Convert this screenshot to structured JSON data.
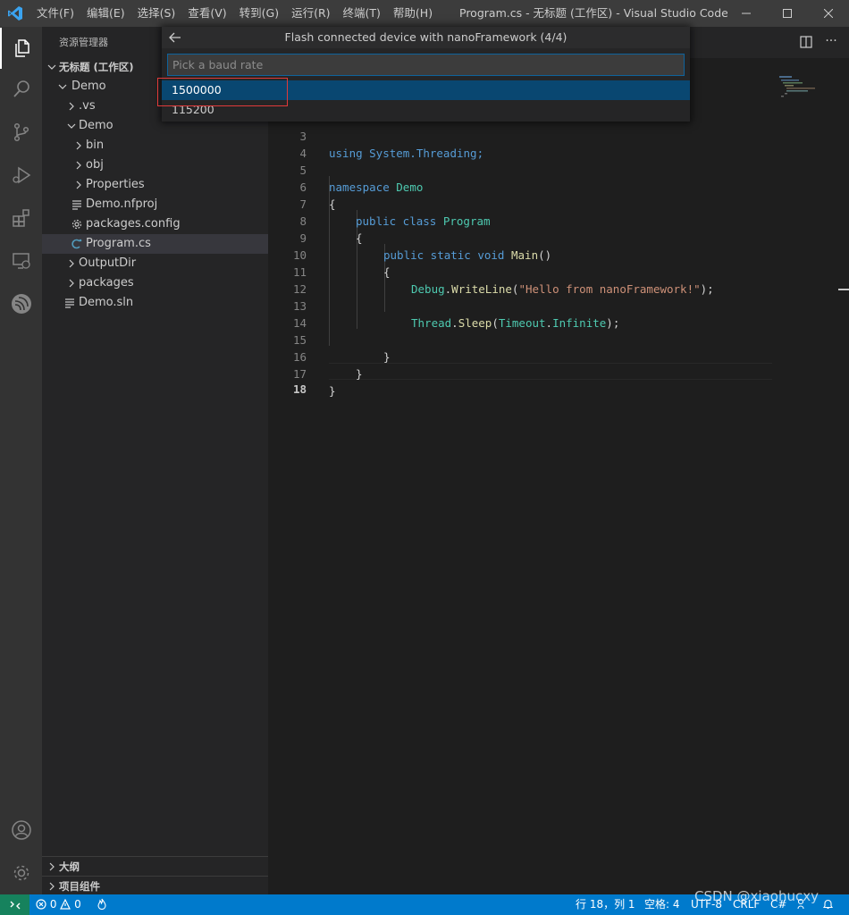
{
  "titlebar": {
    "menu": [
      "文件(F)",
      "编辑(E)",
      "选择(S)",
      "查看(V)",
      "转到(G)",
      "运行(R)",
      "终端(T)",
      "帮助(H)"
    ],
    "window_title": "Program.cs - 无标题 (工作区) - Visual Studio Code [管..."
  },
  "sidebar": {
    "header": "资源管理器",
    "workspace": "无标题 (工作区)",
    "tree": [
      {
        "label": "Demo"
      },
      {
        "label": ".vs"
      },
      {
        "label": "Demo"
      },
      {
        "label": "bin"
      },
      {
        "label": "obj"
      },
      {
        "label": "Properties"
      },
      {
        "label": "Demo.nfproj"
      },
      {
        "label": "packages.config"
      },
      {
        "label": "Program.cs"
      },
      {
        "label": "OutputDir"
      },
      {
        "label": "packages"
      },
      {
        "label": "Demo.sln"
      }
    ],
    "outline": "大纲",
    "project_components": "项目组件"
  },
  "editor": {
    "line_numbers": [
      "3",
      "4",
      "5",
      "6",
      "7",
      "8",
      "9",
      "10",
      "11",
      "12",
      "13",
      "14",
      "15",
      "16",
      "17",
      "18"
    ],
    "lines": {
      "l3": "using System.Threading;",
      "l5_kw": "namespace",
      "l5_ty": "Demo",
      "l6": "{",
      "l7_kw": "public class",
      "l7_ty": "Program",
      "l8": "{",
      "l9_kw": "public static void",
      "l9_fn": "Main",
      "l9_p": "()",
      "l10": "{",
      "l11_ty": "Debug",
      "l11_dot": ".",
      "l11_fn": "WriteLine",
      "l11_open": "(",
      "l11_str": "\"Hello from nanoFramework!\"",
      "l11_close": ");",
      "l13_ty": "Thread",
      "l13_dot": ".",
      "l13_fn": "Sleep",
      "l13_open": "(",
      "l13_ty2": "Timeout",
      "l13_dot2": ".",
      "l13_ty3": "Infinite",
      "l13_close": ");",
      "l15": "}",
      "l16": "}",
      "l17": "}"
    }
  },
  "quickpick": {
    "title": "Flash connected device with nanoFramework (4/4)",
    "placeholder": "Pick a baud rate",
    "items": [
      "1500000",
      "115200"
    ]
  },
  "statusbar": {
    "errors": "0",
    "warnings": "0",
    "position": "行 18，列 1",
    "spaces": "空格: 4",
    "encoding": "UTF-8",
    "eol": "CRLF",
    "language": "C#"
  },
  "watermark": "CSDN @xiaohucxy",
  "colors": {
    "accent": "#007acc",
    "selection": "#094771",
    "highlight_box": "#e03a3a"
  }
}
